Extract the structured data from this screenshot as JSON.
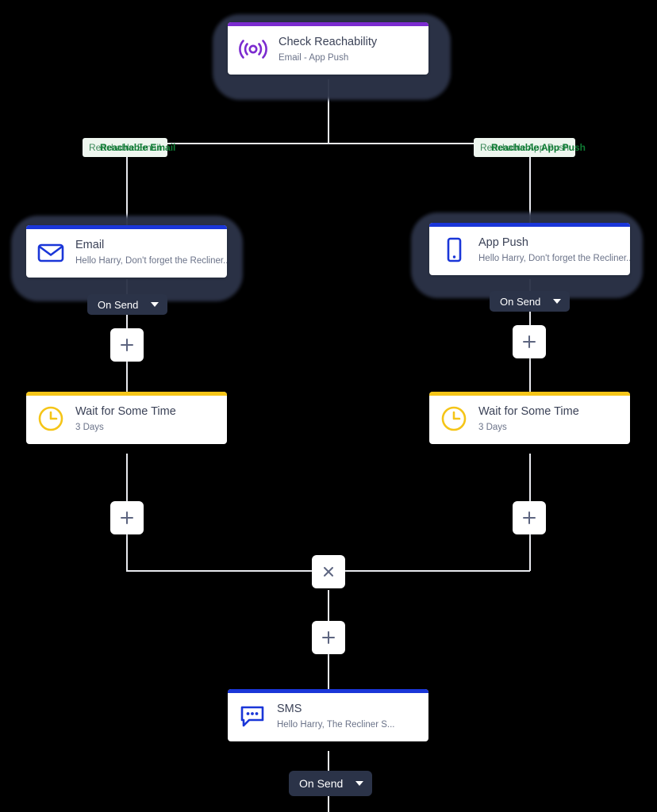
{
  "canvas": {
    "background": "#000000",
    "edge_color": "#e8eaef"
  },
  "nodes": {
    "check_reachability": {
      "title": "Check Reachability",
      "subtitle": "Email - App Push",
      "accent_color": "#7b2bcf",
      "icon": "broadcast-icon",
      "selected": true
    },
    "email": {
      "title": "Email",
      "subtitle": "Hello Harry, Don't forget the Recliner...",
      "accent_color": "#1a36d8",
      "icon": "envelope-icon",
      "selected": true,
      "pill_label": "On Send"
    },
    "app_push": {
      "title": "App Push",
      "subtitle": "Hello Harry, Don't forget the Recliner...",
      "accent_color": "#1a36d8",
      "icon": "mobile-icon",
      "selected": true,
      "pill_label": "On Send"
    },
    "wait_left": {
      "title": "Wait for Some Time",
      "subtitle": "3 Days",
      "accent_color": "#f5c518",
      "icon": "clock-icon"
    },
    "wait_right": {
      "title": "Wait for Some Time",
      "subtitle": "3 Days",
      "accent_color": "#f5c518",
      "icon": "clock-icon"
    },
    "sms": {
      "title": "SMS",
      "subtitle": "Hello Harry, The Recliner S...",
      "accent_color": "#1a36d8",
      "icon": "chat-bubble-icon",
      "pill_label": "On Send"
    }
  },
  "branch_labels": {
    "left": "Reachable Email",
    "right": "Reachable App Push",
    "chip_background": "#eef6ef",
    "text_color": "#0f7c34"
  },
  "buttons": {
    "add_label": "+",
    "merge_label": "×"
  }
}
